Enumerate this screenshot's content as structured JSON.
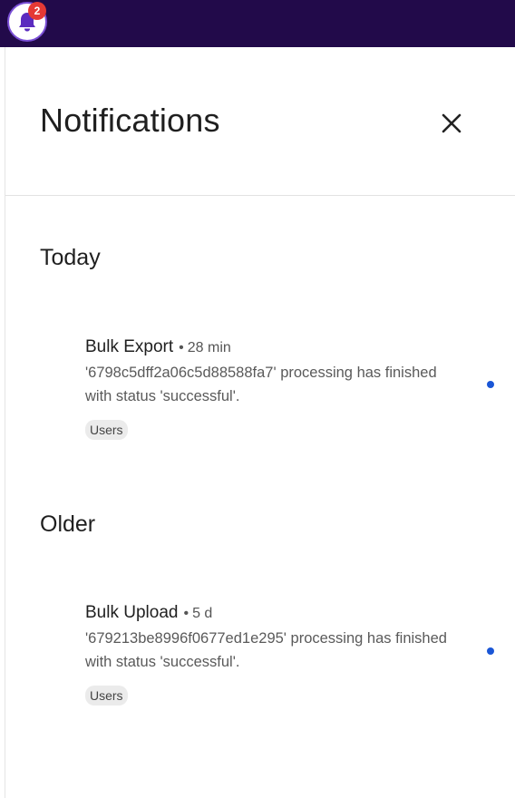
{
  "topbar": {
    "notification_count": "2",
    "bg_color": "#220a4a",
    "icon": "bell-icon"
  },
  "panel": {
    "title": "Notifications",
    "close_icon": "close-icon"
  },
  "sections": [
    {
      "heading": "Today",
      "items": [
        {
          "title": "Bulk Export",
          "separator": "•",
          "time": "28 min",
          "body": "'6798c5dff2a06c5d88588fa7' processing has finished with status 'successful'.",
          "tag": "Users",
          "unread": true
        }
      ]
    },
    {
      "heading": "Older",
      "items": [
        {
          "title": "Bulk Upload",
          "separator": "•",
          "time": "5 d",
          "body": "'679213be8996f0677ed1e295' processing has finished with status 'successful'.",
          "tag": "Users",
          "unread": true
        }
      ]
    }
  ],
  "colors": {
    "unread_dot": "#1a56d6",
    "badge": "#e53935"
  }
}
